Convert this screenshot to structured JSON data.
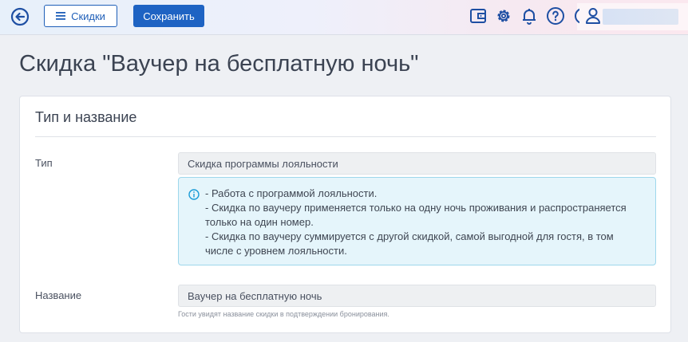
{
  "topbar": {
    "discounts_label": "Скидки",
    "save_label": "Сохранить",
    "icons": [
      "back-arrow-icon",
      "menu-icon",
      "wallet-icon",
      "gear-icon",
      "bell-icon",
      "help-icon",
      "user-icon"
    ],
    "accent": "#1e63c3"
  },
  "page": {
    "title": "Скидка \"Ваучер на бесплатную ночь\""
  },
  "card": {
    "title": "Тип и название",
    "type_label": "Тип",
    "type_value": "Скидка программы лояльности",
    "info_lines": [
      "- Работа с программой лояльности.",
      "- Скидка по ваучеру применяется только на одну ночь проживания и распространяется",
      "только на один номер.",
      "- Скидка по ваучеру суммируется с другой скидкой, самой выгодной для гостя, в том",
      "числе с уровнем лояльности."
    ],
    "name_label": "Название",
    "name_value": "Ваучер на бесплатную ночь",
    "name_hint": "Гости увидят название скидки в подтверждении бронирования."
  }
}
